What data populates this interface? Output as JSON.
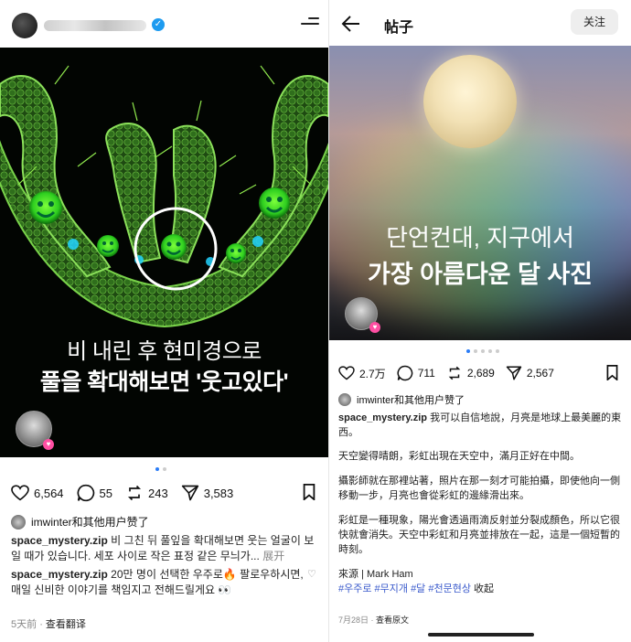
{
  "left": {
    "image": {
      "caption_line1": "비 내린 후 현미경으로",
      "caption_line2": "풀을 확대해보면 '웃고있다'"
    },
    "actions": {
      "likes": "6,564",
      "comments": "55",
      "reposts": "243",
      "shares": "3,583"
    },
    "liked_by": "imwinter和其他用户赞了",
    "post": {
      "username": "space_mystery.zip",
      "text": " 비 그친 뒤 풀잎을 확대해보면 웃는 얼굴이 보일 때가 있습니다. 세포 사이로 작은 표정 같은 무늬가...",
      "more": "展开"
    },
    "comment": {
      "username": "space_mystery.zip",
      "text": " 20만 명이 선택한 우주로🔥 팔로우하시면, 매일 신비한 이야기를 책임지고 전해드릴게요 👀"
    },
    "footer": {
      "time": "5天前",
      "translate": "查看翻译"
    }
  },
  "right": {
    "header": {
      "title": "帖子",
      "follow": "关注"
    },
    "image": {
      "caption_line1": "단언컨대, 지구에서",
      "caption_line2": "가장 아름다운 달 사진"
    },
    "actions": {
      "likes": "2.7万",
      "comments": "711",
      "reposts": "2,689",
      "shares": "2,567"
    },
    "liked_by": "imwinter和其他用户赞了",
    "post": {
      "username": "space_mystery.zip",
      "intro": " 我可以自信地說，月亮是地球上最美麗的東西。",
      "p1": "天空變得晴朗，彩虹出現在天空中，滿月正好在中間。",
      "p2": "攝影師就在那裡站著，照片在那一刻才可能拍攝，即使他向一側移動一步，月亮也會從彩虹的邊緣滑出來。",
      "p3": "彩虹是一種現象，陽光會透過雨滴反射並分裂成顏色，所以它很快就會消失。天空中彩虹和月亮並排放在一起，這是一個短暫的時刻。",
      "source": "來源 | Mark Ham",
      "tags": "#우주로 #무지개 #달 #천문현상",
      "collapse": "收起"
    },
    "footer": {
      "date": "7月28日",
      "original": "查看原文"
    }
  }
}
